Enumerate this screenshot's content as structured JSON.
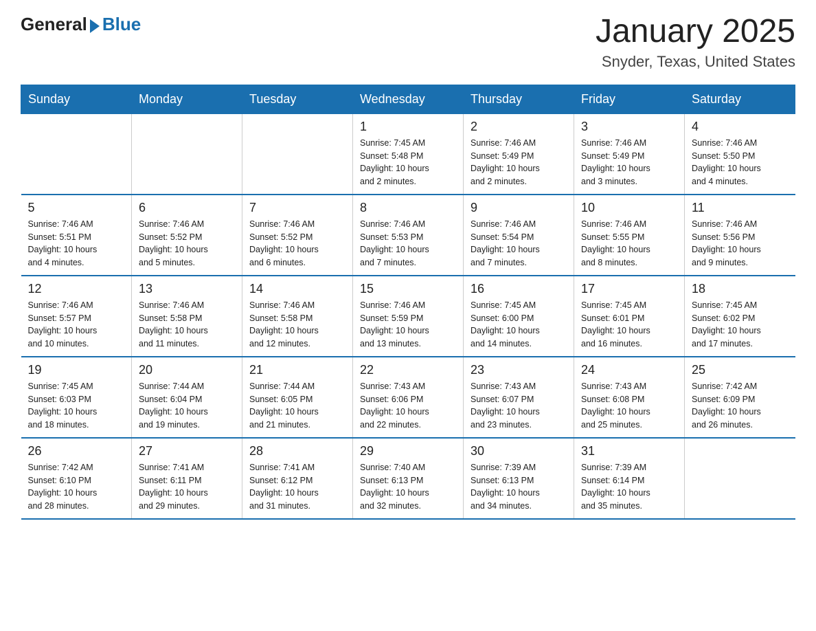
{
  "header": {
    "logo_general": "General",
    "logo_blue": "Blue",
    "title": "January 2025",
    "subtitle": "Snyder, Texas, United States"
  },
  "days_of_week": [
    "Sunday",
    "Monday",
    "Tuesday",
    "Wednesday",
    "Thursday",
    "Friday",
    "Saturday"
  ],
  "weeks": [
    [
      {
        "day": "",
        "info": ""
      },
      {
        "day": "",
        "info": ""
      },
      {
        "day": "",
        "info": ""
      },
      {
        "day": "1",
        "info": "Sunrise: 7:45 AM\nSunset: 5:48 PM\nDaylight: 10 hours\nand 2 minutes."
      },
      {
        "day": "2",
        "info": "Sunrise: 7:46 AM\nSunset: 5:49 PM\nDaylight: 10 hours\nand 2 minutes."
      },
      {
        "day": "3",
        "info": "Sunrise: 7:46 AM\nSunset: 5:49 PM\nDaylight: 10 hours\nand 3 minutes."
      },
      {
        "day": "4",
        "info": "Sunrise: 7:46 AM\nSunset: 5:50 PM\nDaylight: 10 hours\nand 4 minutes."
      }
    ],
    [
      {
        "day": "5",
        "info": "Sunrise: 7:46 AM\nSunset: 5:51 PM\nDaylight: 10 hours\nand 4 minutes."
      },
      {
        "day": "6",
        "info": "Sunrise: 7:46 AM\nSunset: 5:52 PM\nDaylight: 10 hours\nand 5 minutes."
      },
      {
        "day": "7",
        "info": "Sunrise: 7:46 AM\nSunset: 5:52 PM\nDaylight: 10 hours\nand 6 minutes."
      },
      {
        "day": "8",
        "info": "Sunrise: 7:46 AM\nSunset: 5:53 PM\nDaylight: 10 hours\nand 7 minutes."
      },
      {
        "day": "9",
        "info": "Sunrise: 7:46 AM\nSunset: 5:54 PM\nDaylight: 10 hours\nand 7 minutes."
      },
      {
        "day": "10",
        "info": "Sunrise: 7:46 AM\nSunset: 5:55 PM\nDaylight: 10 hours\nand 8 minutes."
      },
      {
        "day": "11",
        "info": "Sunrise: 7:46 AM\nSunset: 5:56 PM\nDaylight: 10 hours\nand 9 minutes."
      }
    ],
    [
      {
        "day": "12",
        "info": "Sunrise: 7:46 AM\nSunset: 5:57 PM\nDaylight: 10 hours\nand 10 minutes."
      },
      {
        "day": "13",
        "info": "Sunrise: 7:46 AM\nSunset: 5:58 PM\nDaylight: 10 hours\nand 11 minutes."
      },
      {
        "day": "14",
        "info": "Sunrise: 7:46 AM\nSunset: 5:58 PM\nDaylight: 10 hours\nand 12 minutes."
      },
      {
        "day": "15",
        "info": "Sunrise: 7:46 AM\nSunset: 5:59 PM\nDaylight: 10 hours\nand 13 minutes."
      },
      {
        "day": "16",
        "info": "Sunrise: 7:45 AM\nSunset: 6:00 PM\nDaylight: 10 hours\nand 14 minutes."
      },
      {
        "day": "17",
        "info": "Sunrise: 7:45 AM\nSunset: 6:01 PM\nDaylight: 10 hours\nand 16 minutes."
      },
      {
        "day": "18",
        "info": "Sunrise: 7:45 AM\nSunset: 6:02 PM\nDaylight: 10 hours\nand 17 minutes."
      }
    ],
    [
      {
        "day": "19",
        "info": "Sunrise: 7:45 AM\nSunset: 6:03 PM\nDaylight: 10 hours\nand 18 minutes."
      },
      {
        "day": "20",
        "info": "Sunrise: 7:44 AM\nSunset: 6:04 PM\nDaylight: 10 hours\nand 19 minutes."
      },
      {
        "day": "21",
        "info": "Sunrise: 7:44 AM\nSunset: 6:05 PM\nDaylight: 10 hours\nand 21 minutes."
      },
      {
        "day": "22",
        "info": "Sunrise: 7:43 AM\nSunset: 6:06 PM\nDaylight: 10 hours\nand 22 minutes."
      },
      {
        "day": "23",
        "info": "Sunrise: 7:43 AM\nSunset: 6:07 PM\nDaylight: 10 hours\nand 23 minutes."
      },
      {
        "day": "24",
        "info": "Sunrise: 7:43 AM\nSunset: 6:08 PM\nDaylight: 10 hours\nand 25 minutes."
      },
      {
        "day": "25",
        "info": "Sunrise: 7:42 AM\nSunset: 6:09 PM\nDaylight: 10 hours\nand 26 minutes."
      }
    ],
    [
      {
        "day": "26",
        "info": "Sunrise: 7:42 AM\nSunset: 6:10 PM\nDaylight: 10 hours\nand 28 minutes."
      },
      {
        "day": "27",
        "info": "Sunrise: 7:41 AM\nSunset: 6:11 PM\nDaylight: 10 hours\nand 29 minutes."
      },
      {
        "day": "28",
        "info": "Sunrise: 7:41 AM\nSunset: 6:12 PM\nDaylight: 10 hours\nand 31 minutes."
      },
      {
        "day": "29",
        "info": "Sunrise: 7:40 AM\nSunset: 6:13 PM\nDaylight: 10 hours\nand 32 minutes."
      },
      {
        "day": "30",
        "info": "Sunrise: 7:39 AM\nSunset: 6:13 PM\nDaylight: 10 hours\nand 34 minutes."
      },
      {
        "day": "31",
        "info": "Sunrise: 7:39 AM\nSunset: 6:14 PM\nDaylight: 10 hours\nand 35 minutes."
      },
      {
        "day": "",
        "info": ""
      }
    ]
  ]
}
